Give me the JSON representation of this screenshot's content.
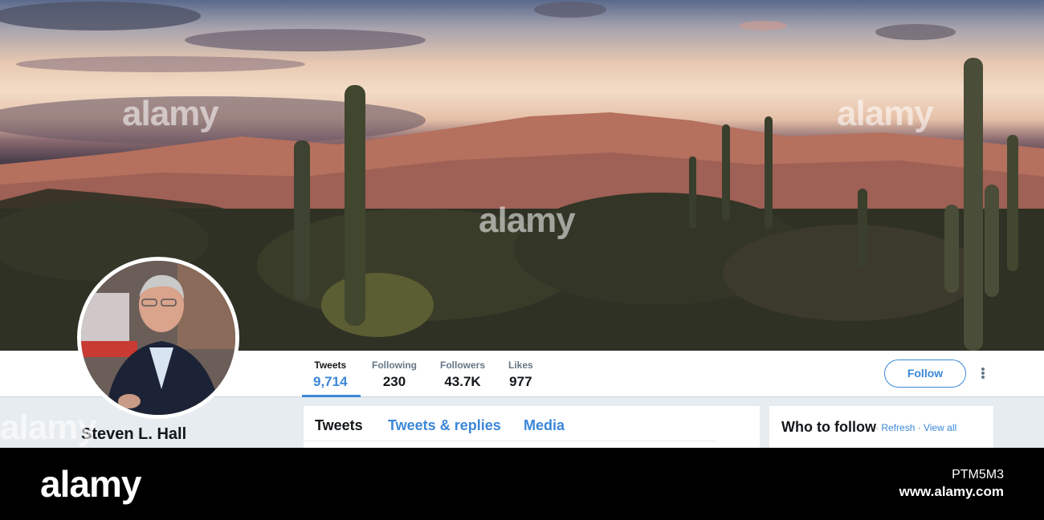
{
  "profile": {
    "name": "Steven L. Hall"
  },
  "stats": [
    {
      "label": "Tweets",
      "value": "9,714"
    },
    {
      "label": "Following",
      "value": "230"
    },
    {
      "label": "Followers",
      "value": "43.7K"
    },
    {
      "label": "Likes",
      "value": "977"
    }
  ],
  "actions": {
    "follow_label": "Follow"
  },
  "tabs": [
    {
      "label": "Tweets"
    },
    {
      "label": "Tweets & replies"
    },
    {
      "label": "Media"
    }
  ],
  "who_to_follow": {
    "title": "Who to follow",
    "separator": " · ",
    "refresh": "Refresh",
    "view_all": "View all"
  },
  "watermark": {
    "brand": "alamy",
    "image_id": "PTM5M3",
    "site": "www.alamy.com"
  },
  "colors": {
    "accent": "#3b87d8",
    "background": "#e6ecf0",
    "footer": "#000000"
  }
}
